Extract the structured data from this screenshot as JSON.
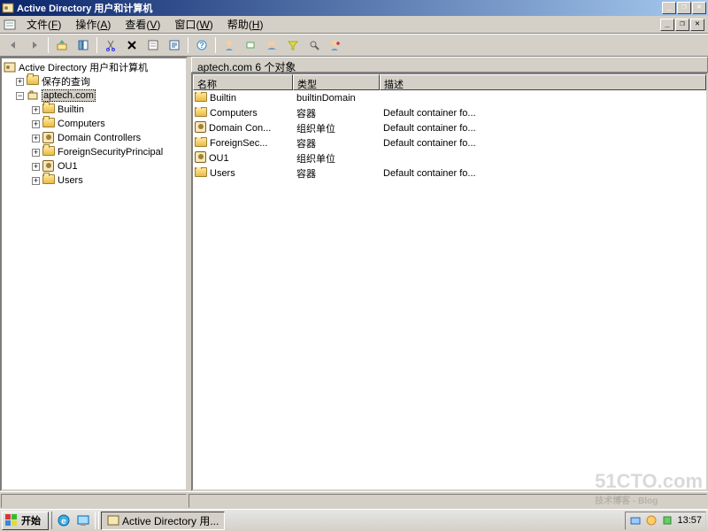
{
  "window": {
    "title": "Active Directory 用户和计算机"
  },
  "menubar": [
    {
      "label": "文件",
      "mn": "F"
    },
    {
      "label": "操作",
      "mn": "A"
    },
    {
      "label": "查看",
      "mn": "V"
    },
    {
      "label": "窗口",
      "mn": "W"
    },
    {
      "label": "帮助",
      "mn": "H"
    }
  ],
  "tree": {
    "root": "Active Directory 用户和计算机",
    "saved_queries": "保存的查询",
    "domain": "aptech.com",
    "children": [
      "Builtin",
      "Computers",
      "Domain Controllers",
      "ForeignSecurityPrincipal",
      "OU1",
      "Users"
    ]
  },
  "list": {
    "header_text": "aptech.com   6 个对象",
    "columns": [
      "名称",
      "类型",
      "描述"
    ],
    "rows": [
      {
        "name": "Builtin",
        "type": "builtinDomain",
        "desc": "",
        "icon": "folder"
      },
      {
        "name": "Computers",
        "type": "容器",
        "desc": "Default container fo...",
        "icon": "folder"
      },
      {
        "name": "Domain Con...",
        "type": "组织单位",
        "desc": "Default container fo...",
        "icon": "ou"
      },
      {
        "name": "ForeignSec...",
        "type": "容器",
        "desc": "Default container fo...",
        "icon": "folder"
      },
      {
        "name": "OU1",
        "type": "组织单位",
        "desc": "",
        "icon": "ou"
      },
      {
        "name": "Users",
        "type": "容器",
        "desc": "Default container fo...",
        "icon": "folder"
      }
    ]
  },
  "taskbar": {
    "start": "开始",
    "task": "Active Directory 用...",
    "time": "13:57"
  },
  "watermark": {
    "main": "51CTO.com",
    "sub": "技术博客 - Blog"
  }
}
